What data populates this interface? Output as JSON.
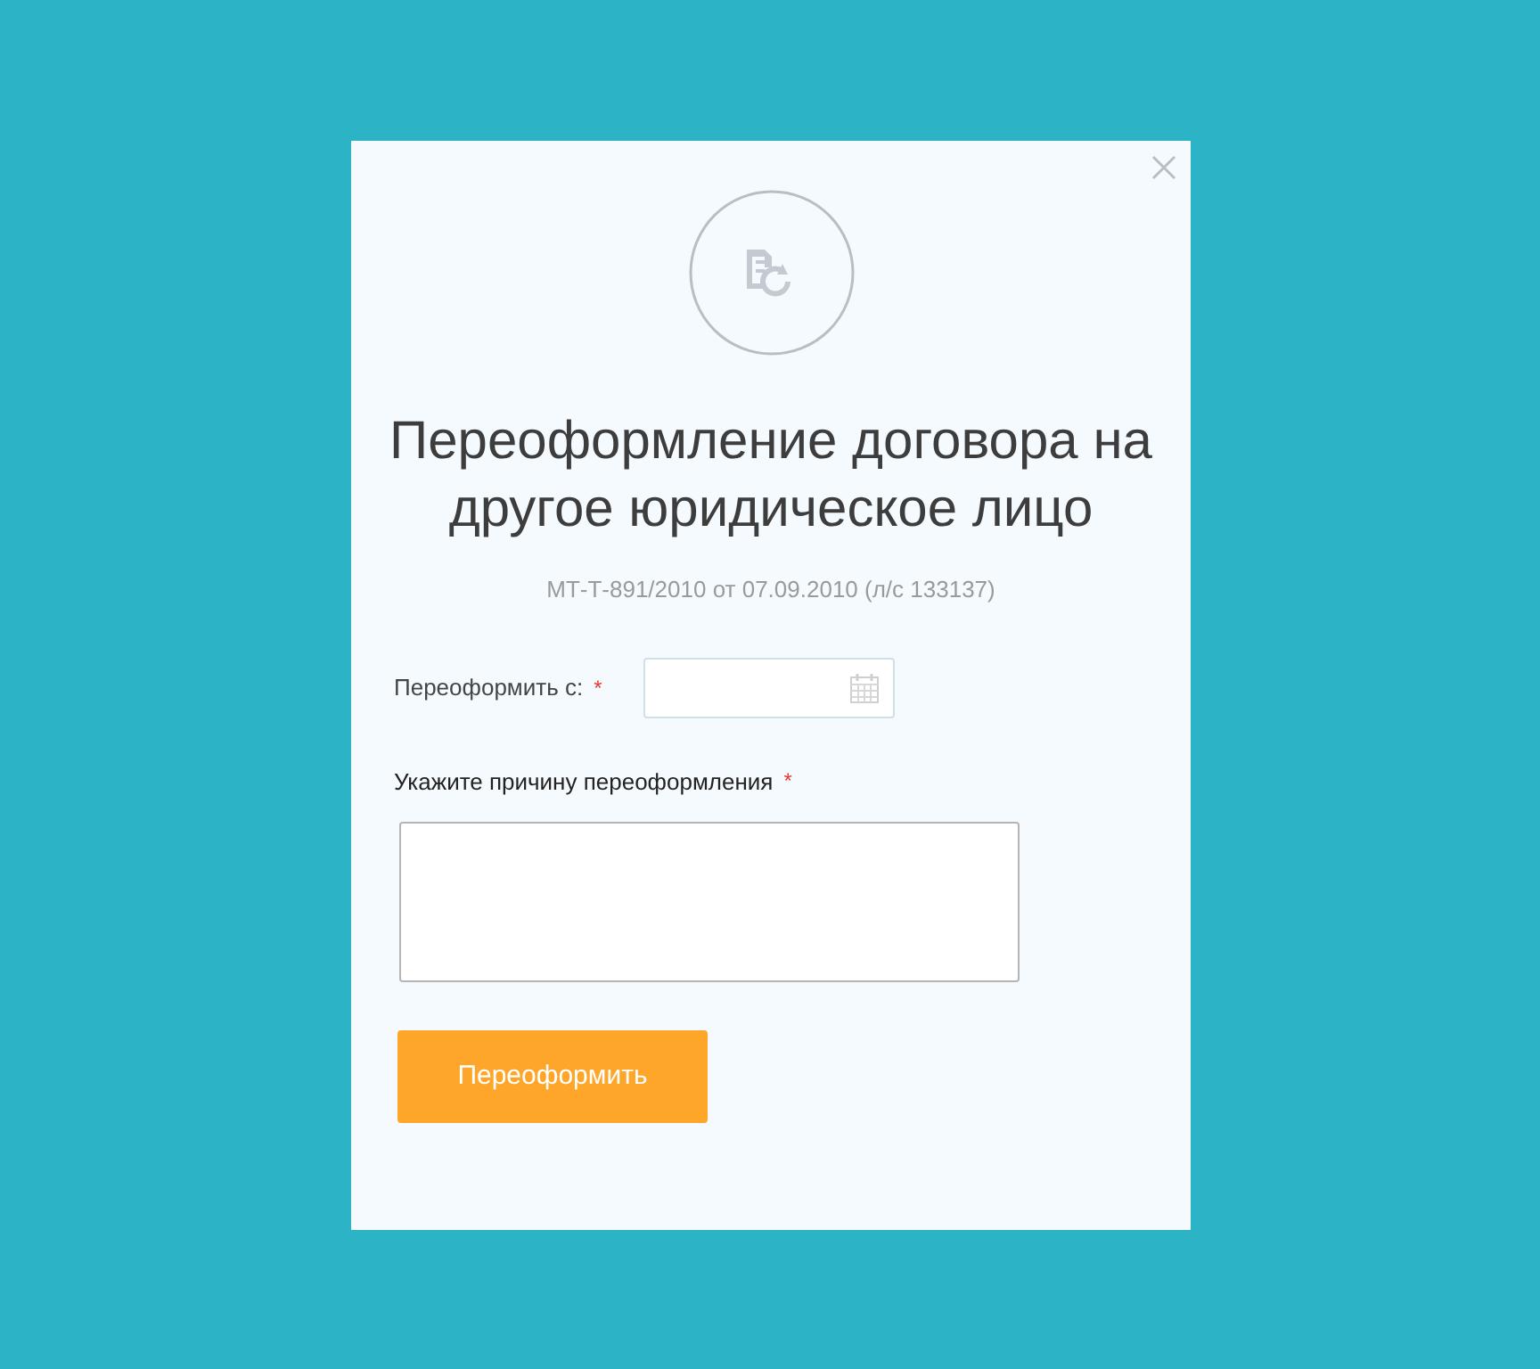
{
  "dialog": {
    "title": "Переоформление договора на другое юридическое лицо",
    "subtitle": "МТ-Т-891/2010 от 07.09.2010 (л/с 133137)",
    "fields": [
      {
        "kind": "date",
        "label": "Переоформить с:",
        "required_mark": "*"
      },
      {
        "kind": "textarea",
        "label": "Укажите причину переоформления",
        "required_mark": "*"
      }
    ],
    "submit_button": "Переоформить"
  }
}
